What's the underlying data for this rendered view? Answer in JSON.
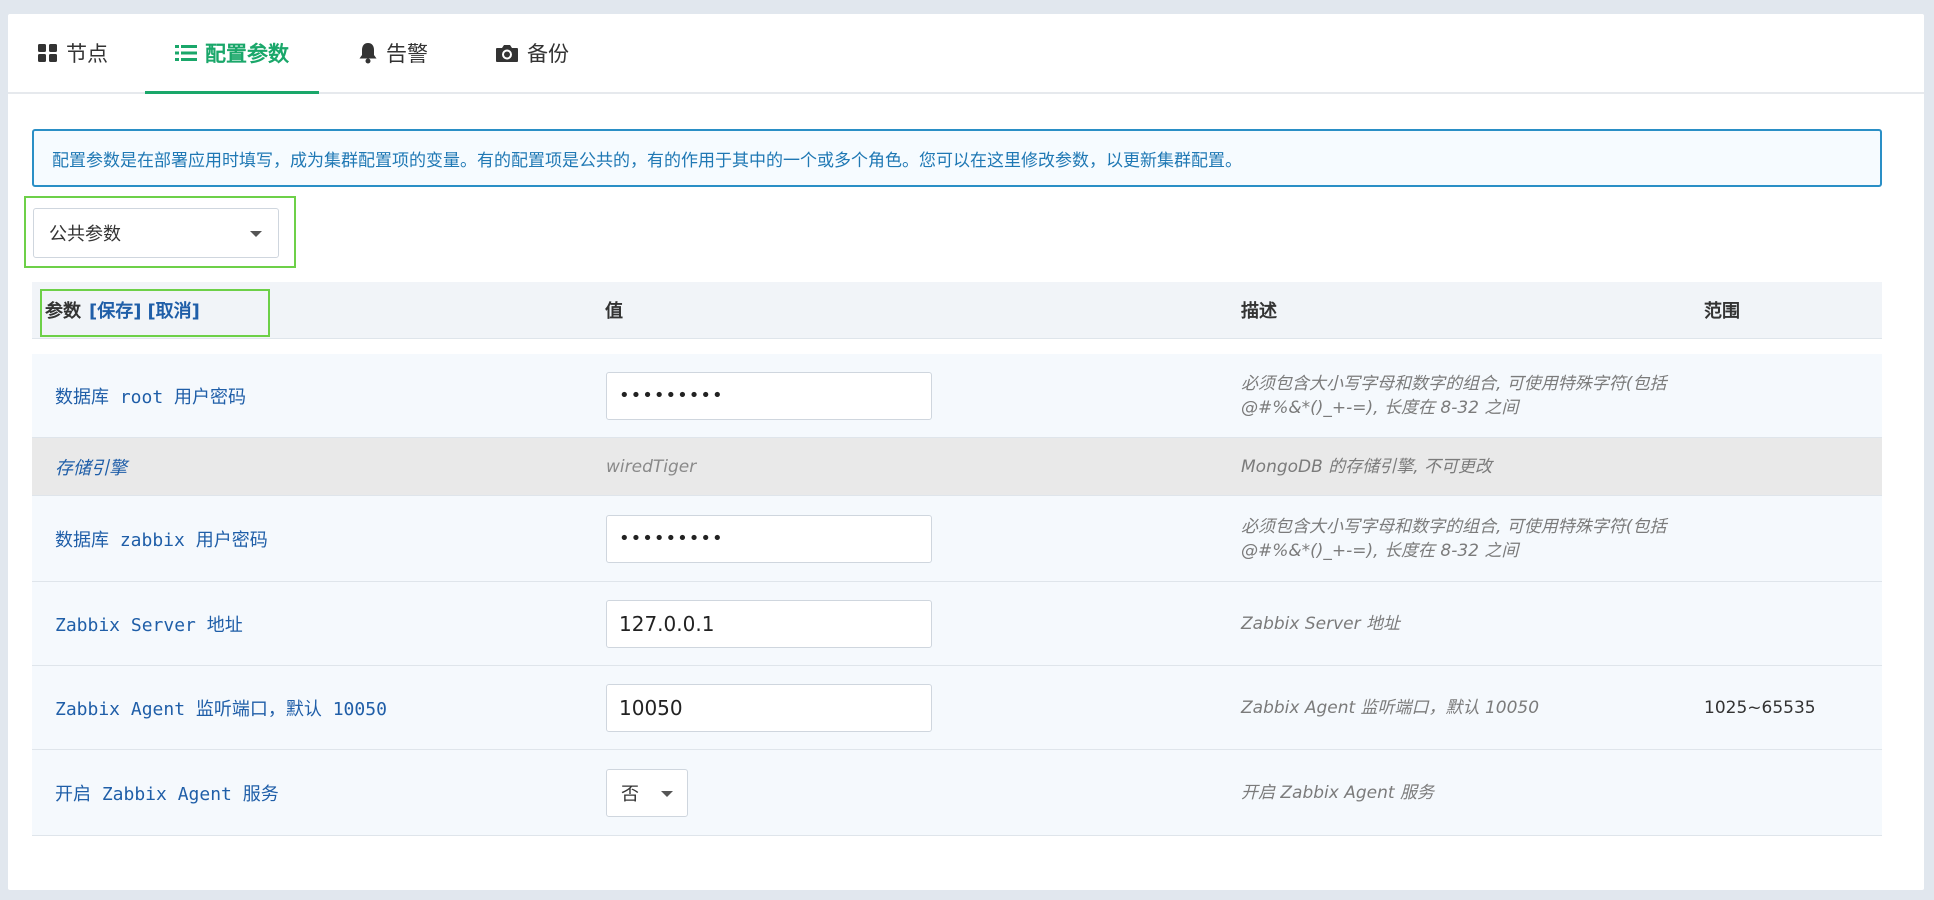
{
  "tabs": [
    {
      "label": "节点",
      "icon": "grid-icon"
    },
    {
      "label": "配置参数",
      "icon": "list-icon",
      "active": true
    },
    {
      "label": "告警",
      "icon": "bell-icon"
    },
    {
      "label": "备份",
      "icon": "camera-icon"
    }
  ],
  "notice": "配置参数是在部署应用时填写，成为集群配置项的变量。有的配置项是公共的，有的作用于其中的一个或多个角色。您可以在这里修改参数，以更新集群配置。",
  "scope_select": {
    "value": "公共参数"
  },
  "table": {
    "headers": {
      "param": "参数",
      "save": "[保存]",
      "cancel": "[取消]",
      "value": "值",
      "desc": "描述",
      "range": "范围"
    },
    "rows": [
      {
        "name": "数据库 root 用户密码",
        "value": "•••••••••",
        "desc": "必须包含大小写字母和数字的组合, 可使用特殊字符(包括 @#%&*()_+-=), 长度在 8-32 之间",
        "range": ""
      },
      {
        "name": "存储引擎",
        "value": "wiredTiger",
        "desc": "MongoDB 的存储引擎, 不可更改",
        "range": ""
      },
      {
        "name": "数据库 zabbix 用户密码",
        "value": "•••••••••",
        "desc": "必须包含大小写字母和数字的组合, 可使用特殊字符(包括 @#%&*()_+-=), 长度在 8-32 之间",
        "range": ""
      },
      {
        "name": "Zabbix Server 地址",
        "value": "127.0.0.1",
        "desc": "Zabbix Server 地址",
        "range": ""
      },
      {
        "name": "Zabbix Agent 监听端口，默认 10050",
        "value": "10050",
        "desc": "Zabbix Agent 监听端口，默认 10050",
        "range": "1025~65535"
      },
      {
        "name": "开启 Zabbix Agent 服务",
        "value": "否",
        "desc": "开启 Zabbix Agent 服务",
        "range": ""
      }
    ]
  },
  "colors": {
    "accent": "#1aa76a",
    "link": "#1f5ea8",
    "notice_border": "#2a8fc6",
    "highlight": "#6dd048"
  }
}
